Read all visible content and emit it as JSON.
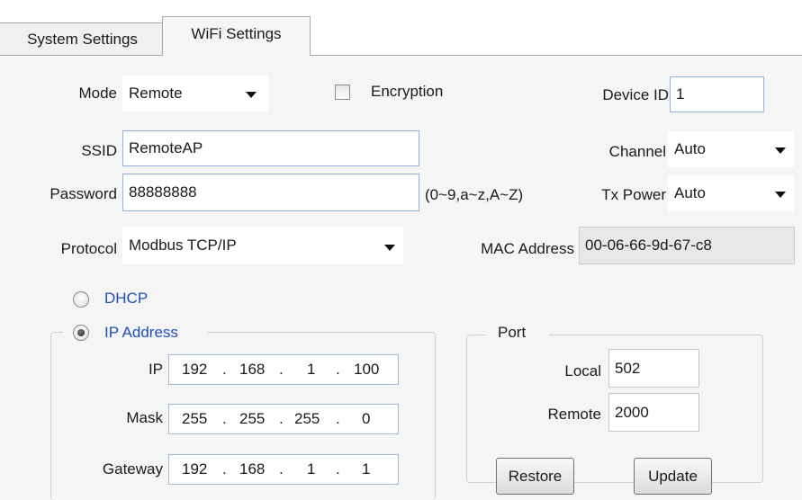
{
  "tabs": [
    {
      "label": "System Settings",
      "active": false
    },
    {
      "label": "WiFi Settings",
      "active": true
    }
  ],
  "mode": {
    "label": "Mode",
    "value": "Remote"
  },
  "encryption": {
    "label": "Encryption",
    "checked": false
  },
  "device_id": {
    "label": "Device ID",
    "value": "1"
  },
  "ssid": {
    "label": "SSID",
    "value": "RemoteAP"
  },
  "channel": {
    "label": "Channel",
    "value": "Auto"
  },
  "password": {
    "label": "Password",
    "value": "88888888",
    "hint": "(0~9,a~z,A~Z)"
  },
  "tx_power": {
    "label": "Tx Power",
    "value": "Auto"
  },
  "protocol": {
    "label": "Protocol",
    "value": "Modbus TCP/IP"
  },
  "mac": {
    "label": "MAC Address",
    "value": "00-06-66-9d-67-c8"
  },
  "ip_mode": {
    "dhcp_label": "DHCP",
    "ip_label": "IP Address",
    "selected": "IP Address"
  },
  "ip": {
    "label": "IP",
    "octets": [
      "192",
      "168",
      "1",
      "100"
    ]
  },
  "mask": {
    "label": "Mask",
    "octets": [
      "255",
      "255",
      "255",
      "0"
    ]
  },
  "gateway": {
    "label": "Gateway",
    "octets": [
      "192",
      "168",
      "1",
      "1"
    ]
  },
  "port": {
    "title": "Port",
    "local_label": "Local",
    "local_value": "502",
    "remote_label": "Remote",
    "remote_value": "2000"
  },
  "buttons": {
    "restore": "Restore",
    "update": "Update"
  },
  "colors": {
    "panel_bg": "#f5f5f5",
    "radio_label": "#1f4fb5",
    "field_border": "#8fb4e0"
  },
  "icons": {
    "dropdown": "chevron-down-icon",
    "checkbox": "checkbox-icon",
    "radio": "radio-icon"
  }
}
